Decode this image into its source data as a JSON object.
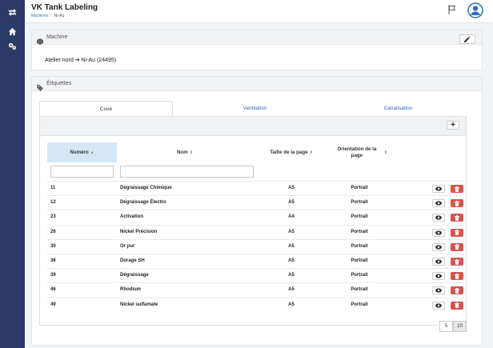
{
  "app": {
    "title": "VK Tank Labeling"
  },
  "breadcrumb": {
    "items": [
      "Machines",
      "Ni-Au"
    ]
  },
  "machine_section": {
    "title": "Machine",
    "name": "Atelier nord ➔ Ni-Au (24495)"
  },
  "labels_section": {
    "title": "Étiquettes"
  },
  "tabs": [
    {
      "label": "Cuve",
      "active": true
    },
    {
      "label": "Ventilation",
      "active": false
    },
    {
      "label": "Canalisation",
      "active": false
    }
  ],
  "toolbar": {
    "add_label": "+"
  },
  "table": {
    "headers": {
      "numero": "Numéro",
      "nom": "Nom",
      "taille": "Taille de la page",
      "orientation": "Orientation de la page"
    },
    "sorted_column": "numero",
    "rows": [
      {
        "numero": "11",
        "nom": "Dégraissage Chimique",
        "taille": "A5",
        "orientation": "Portrait"
      },
      {
        "numero": "12",
        "nom": "Dégraissage Électro",
        "taille": "A5",
        "orientation": "Portrait"
      },
      {
        "numero": "23",
        "nom": "Activation",
        "taille": "A4",
        "orientation": "Portrait"
      },
      {
        "numero": "26",
        "nom": "Nickel Précision",
        "taille": "A5",
        "orientation": "Portrait"
      },
      {
        "numero": "30",
        "nom": "Or pur",
        "taille": "A5",
        "orientation": "Portrait"
      },
      {
        "numero": "36",
        "nom": "Dorage SH",
        "taille": "A5",
        "orientation": "Portrait"
      },
      {
        "numero": "39",
        "nom": "Dégraissage",
        "taille": "A5",
        "orientation": "Portrait"
      },
      {
        "numero": "46",
        "nom": "Rhodium",
        "taille": "A5",
        "orientation": "Portrait"
      },
      {
        "numero": "49",
        "nom": "Nickel sulfamate",
        "taille": "A5",
        "orientation": "Portrait"
      }
    ]
  },
  "pagination": {
    "sizes": [
      "5",
      "10"
    ],
    "selected": "10"
  },
  "icons": {
    "sidebar": [
      "exchange-icon",
      "home-icon",
      "cogs-icon"
    ],
    "header": [
      "flag-icon",
      "user-avatar-icon"
    ],
    "section": [
      "cube-icon",
      "tags-icon",
      "edit-icon"
    ],
    "row_actions": [
      "eye-icon",
      "trash-icon"
    ]
  },
  "colors": {
    "sidebar": "#2b3a67",
    "link": "#2f6db0",
    "delete": "#d9534f",
    "sorted_header": "#d6e6f5"
  }
}
